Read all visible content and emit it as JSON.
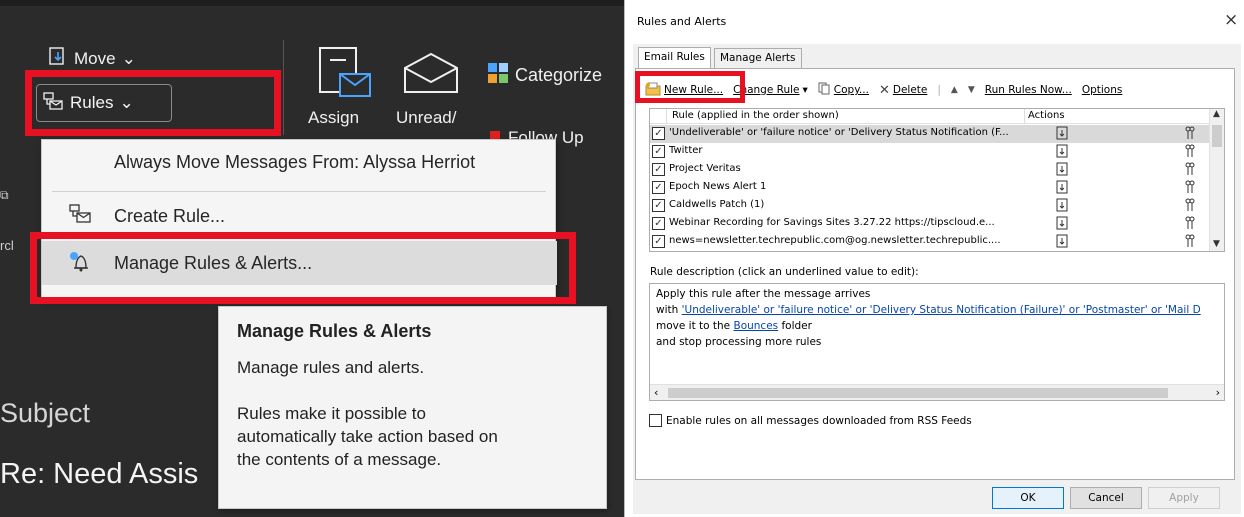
{
  "left_panel": {
    "ribbon": {
      "move_label": "Move",
      "rules_label": "Rules",
      "assign_label": "Assign",
      "unread_label": "Unread/",
      "categorize_label": "Categorize",
      "followup_label": "Follow Up",
      "side_fragment": "rcl"
    },
    "rules_menu": {
      "items": [
        {
          "label": "Always Move Messages From: Alyssa Herriot"
        },
        {
          "label": "Create Rule..."
        },
        {
          "label": "Manage Rules & Alerts..."
        }
      ]
    },
    "tooltip": {
      "title": "Manage Rules & Alerts",
      "subtitle": "Manage rules and alerts.",
      "line1": "Rules make it possible to",
      "line2": "automatically take action based on",
      "line3": "the contents of a message."
    },
    "list": {
      "subject_header": "Subject",
      "row_subject": "Re: Need Assis"
    },
    "highlight_color": "#e81123"
  },
  "dialog": {
    "title": "Rules and Alerts",
    "close_glyph": "×",
    "tabs": [
      {
        "label": "Email Rules",
        "active": true
      },
      {
        "label": "Manage Alerts",
        "active": false
      }
    ],
    "toolbar": {
      "new_rule": "New Rule...",
      "change_rule": "Change Rule",
      "copy": "Copy...",
      "delete": "Delete",
      "run_rules_now": "Run Rules Now...",
      "options": "Options"
    },
    "columns": {
      "rule": "Rule (applied in the order shown)",
      "actions": "Actions"
    },
    "rules": [
      {
        "name": "'Undeliverable' or 'failure notice' or 'Delivery Status Notification (F...",
        "checked": true,
        "selected": true
      },
      {
        "name": "Twitter",
        "checked": true,
        "selected": false
      },
      {
        "name": "Project Veritas",
        "checked": true,
        "selected": false
      },
      {
        "name": "Epoch News Alert 1",
        "checked": true,
        "selected": false
      },
      {
        "name": "Caldwells Patch (1)",
        "checked": true,
        "selected": false
      },
      {
        "name": "Webinar Recording for Savings Sites 3.27.22  https://tipscloud.e...",
        "checked": true,
        "selected": false
      },
      {
        "name": "news=newsletter.techrepublic.com@og.newsletter.techrepublic....",
        "checked": true,
        "selected": false
      }
    ],
    "description": {
      "label": "Rule description (click an underlined value to edit):",
      "line1": "Apply this rule after the message arrives",
      "line2_prefix": "with ",
      "line2_link": "'Undeliverable' or 'failure notice' or 'Delivery Status Notification (Failure)' or 'Postmaster' or 'Mail D",
      "line3_prefix": "move it to the ",
      "line3_link": "Bounces",
      "line3_suffix": " folder",
      "line4": "  and stop processing more rules"
    },
    "rss_checkbox": {
      "label": "Enable rules on all messages downloaded from RSS Feeds",
      "checked": false
    },
    "buttons": {
      "ok": "OK",
      "cancel": "Cancel",
      "apply": "Apply"
    }
  }
}
